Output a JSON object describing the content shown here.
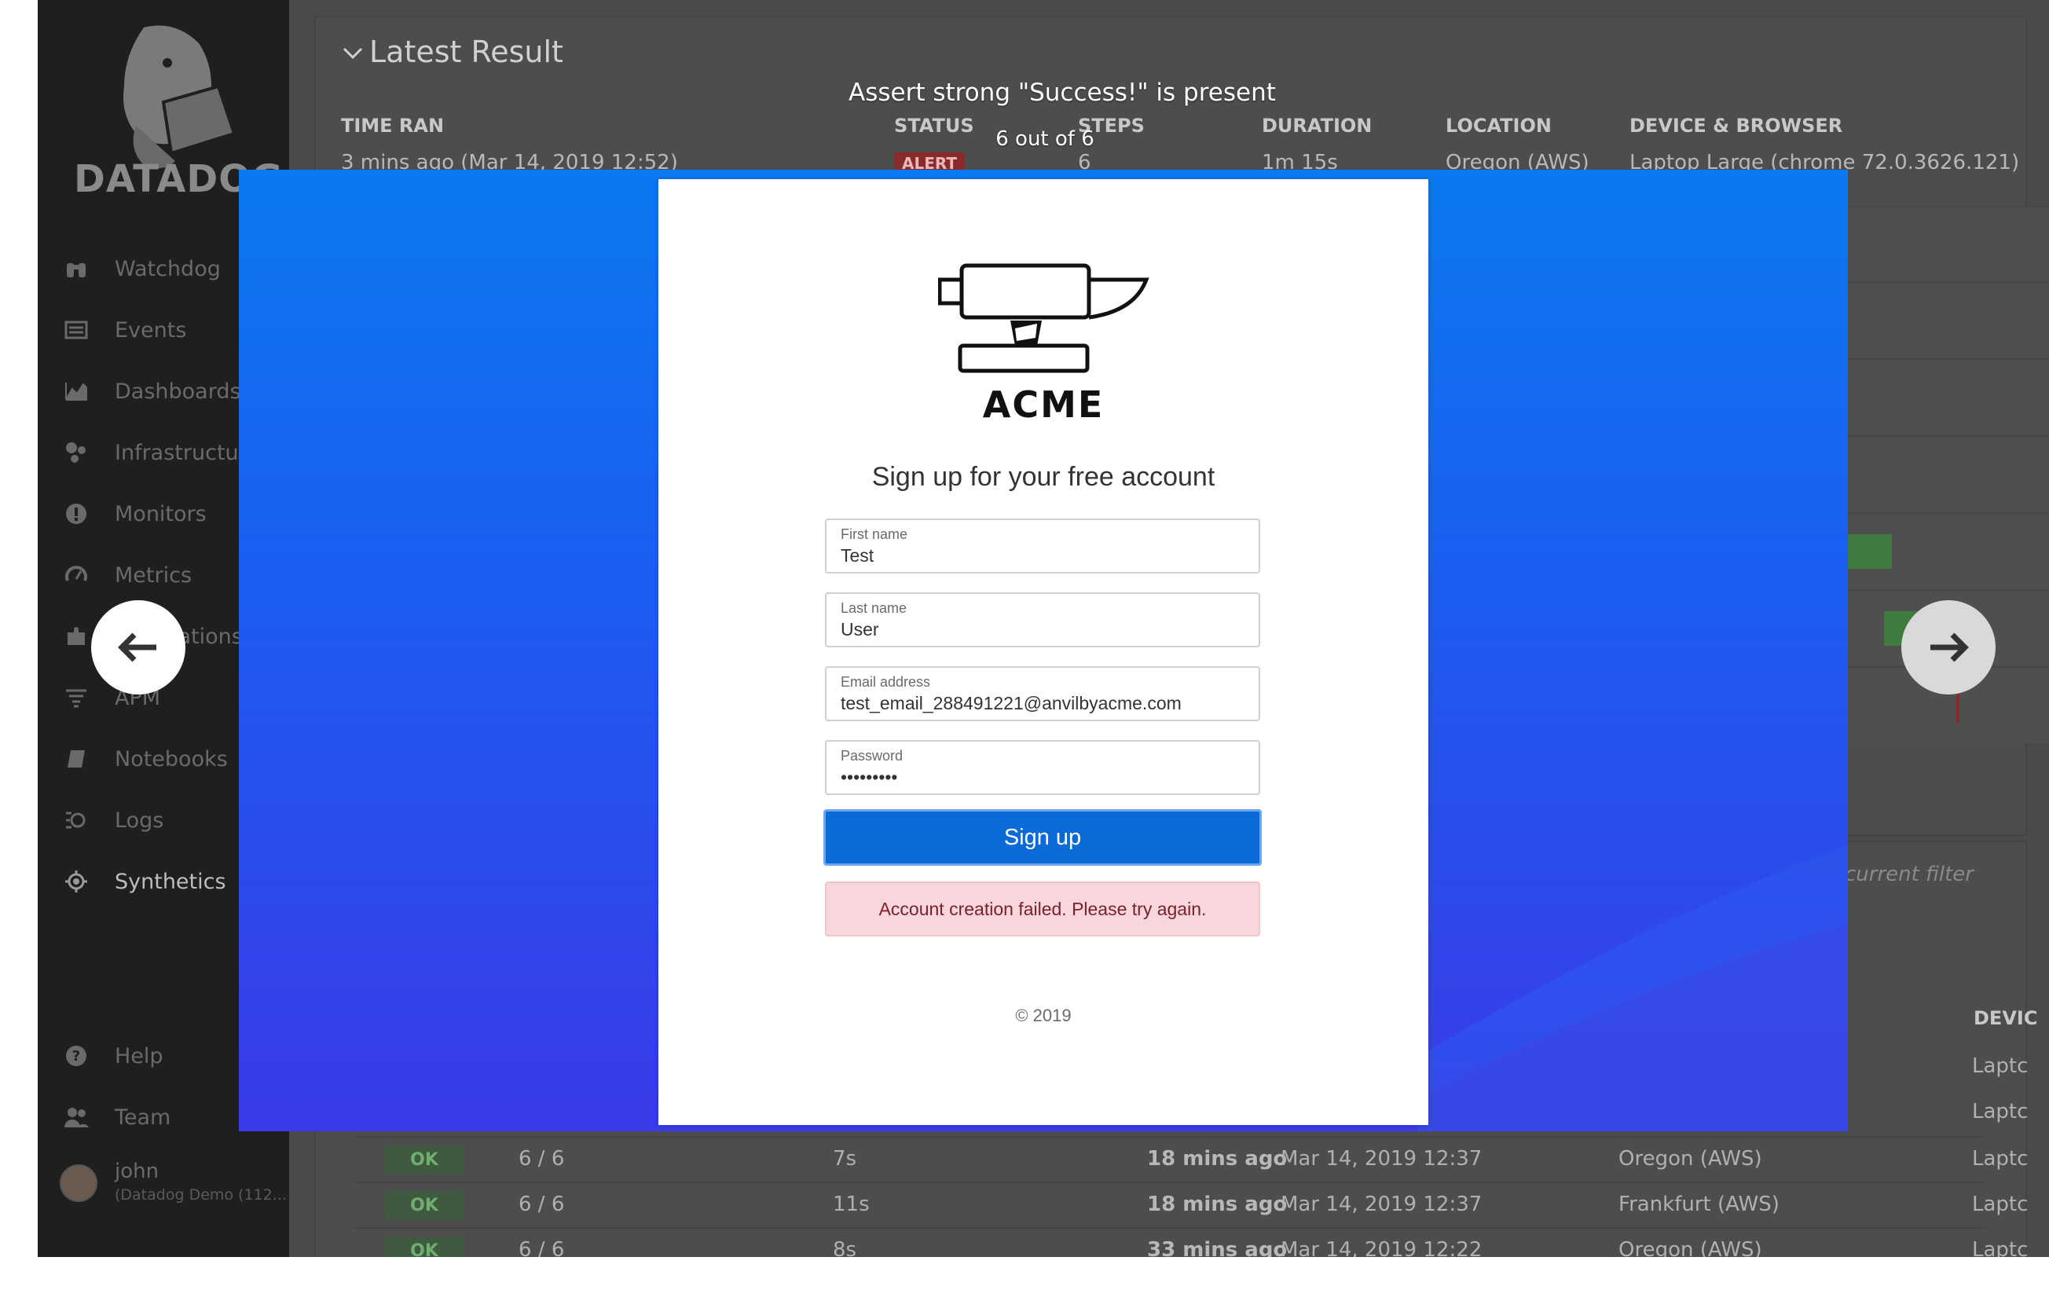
{
  "sidebar": {
    "logo_text": "DATADOG",
    "items": [
      {
        "label": "Watchdog",
        "icon": "binoculars-icon"
      },
      {
        "label": "Events",
        "icon": "events-list-icon"
      },
      {
        "label": "Dashboards",
        "icon": "dashboard-chart-icon"
      },
      {
        "label": "Infrastructure",
        "icon": "infrastructure-icon"
      },
      {
        "label": "Monitors",
        "icon": "alert-circle-icon"
      },
      {
        "label": "Metrics",
        "icon": "gauge-icon"
      },
      {
        "label": "Integrations",
        "icon": "puzzle-icon"
      },
      {
        "label": "APM",
        "icon": "apm-icon"
      },
      {
        "label": "Notebooks",
        "icon": "notebook-icon"
      },
      {
        "label": "Logs",
        "icon": "logs-icon"
      },
      {
        "label": "Synthetics",
        "icon": "synthetics-icon"
      }
    ],
    "help": {
      "label": "Help",
      "icon": "help-icon"
    },
    "team": {
      "label": "Team",
      "icon": "team-icon"
    },
    "user": {
      "name": "john",
      "org": "(Datadog Demo (112..."
    }
  },
  "latest_result": {
    "title": "Latest Result",
    "columns": [
      "TIME RAN",
      "STATUS",
      "STEPS",
      "DURATION",
      "LOCATION",
      "DEVICE & BROWSER"
    ],
    "values": {
      "time_ran": "3 mins ago (Mar 14, 2019 12:52)",
      "status": "ALERT",
      "steps": "6",
      "duration": "1m 15s",
      "location": "Oregon (AWS)",
      "device": "Laptop Large (chrome 72.0.3626.121)"
    }
  },
  "results_table": {
    "filter_hint": "he current filter",
    "device_header": "DEVIC",
    "rows": [
      {
        "status": "OK",
        "steps": "6 / 6",
        "duration": "7s",
        "ago": "18 mins ago",
        "date": "Mar 14, 2019 12:37",
        "location": "Oregon (AWS)",
        "device": "Laptc"
      },
      {
        "status": "OK",
        "steps": "6 / 6",
        "duration": "11s",
        "ago": "18 mins ago",
        "date": "Mar 14, 2019 12:37",
        "location": "Frankfurt (AWS)",
        "device": "Laptc"
      },
      {
        "status": "OK",
        "steps": "6 / 6",
        "duration": "8s",
        "ago": "33 mins ago",
        "date": "Mar 14, 2019 12:22",
        "location": "Oregon (AWS)",
        "device": "Laptc"
      }
    ],
    "hidden_device_cells": [
      "Laptc",
      "Laptc"
    ]
  },
  "step_viewer": {
    "title": "Assert strong \"Success!\" is present",
    "counter": "6 out of 6"
  },
  "signup_page": {
    "brand": "ACME",
    "heading": "Sign up for your free account",
    "fields": [
      {
        "label": "First name",
        "value": "Test"
      },
      {
        "label": "Last name",
        "value": "User"
      },
      {
        "label": "Email address",
        "value": "test_email_288491221@anvilbyacme.com"
      },
      {
        "label": "Password",
        "value": "•••••••••"
      }
    ],
    "button_label": "Sign up",
    "error_message": "Account creation failed. Please try again.",
    "footer": "© 2019"
  },
  "colors": {
    "signup_button": "#0a6bd8",
    "error_bg": "#f7d7dc",
    "gradient_top": "#0b79ef",
    "gradient_bottom": "#3a3ae8"
  }
}
